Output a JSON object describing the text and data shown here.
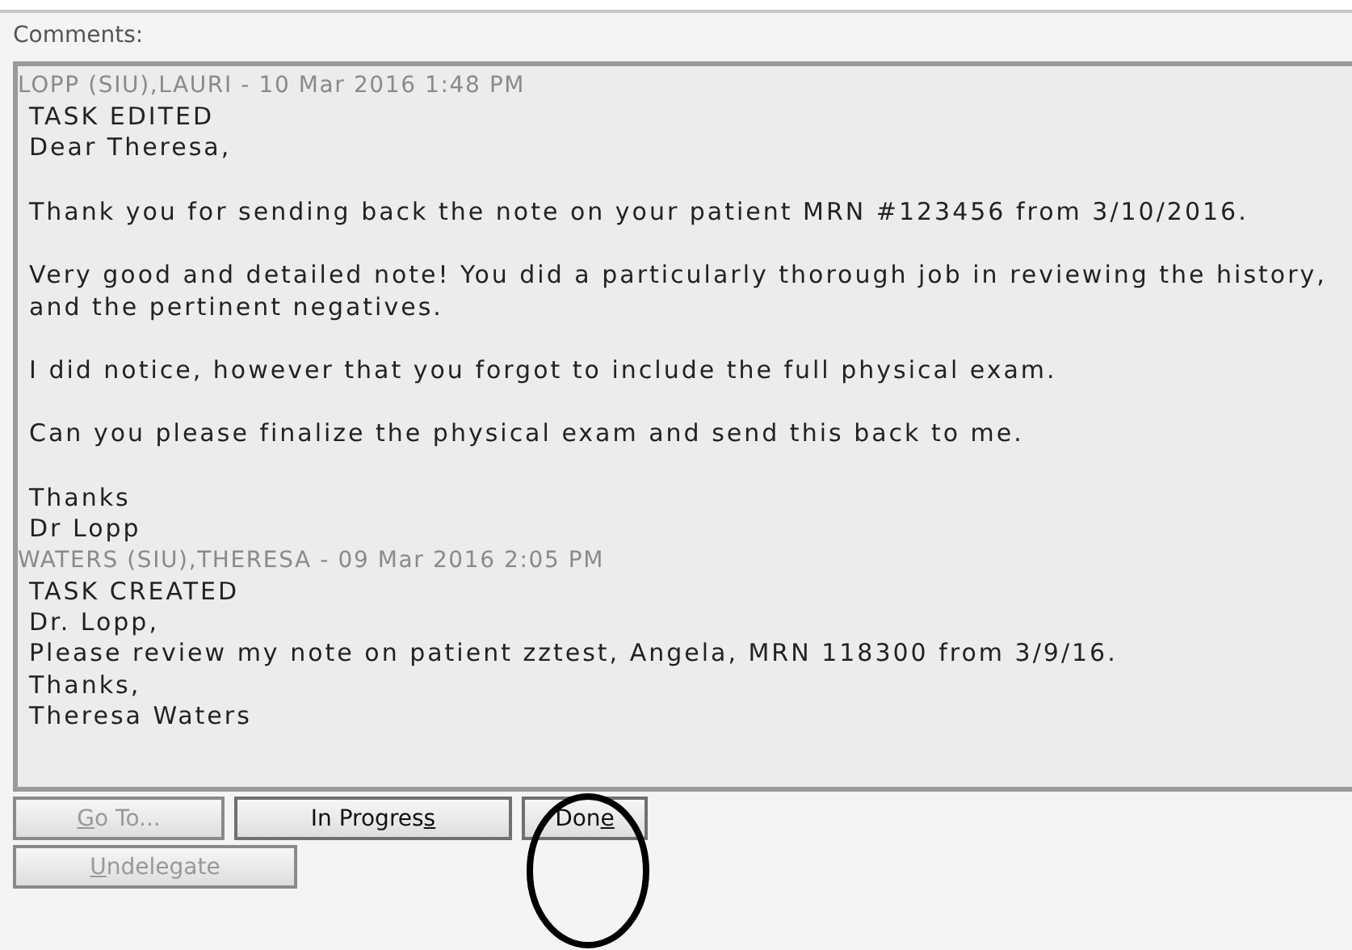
{
  "label": "Comments:",
  "comments": [
    {
      "header": "LOPP (SIU),LAURI - 10 Mar 2016 1:48 PM",
      "paragraphs": [
        [
          "TASK EDITED",
          "Dear Theresa,"
        ],
        [
          "Thank you for sending back the note on your patient MRN #123456 from 3/10/2016."
        ],
        [
          "Very good and detailed note! You did a particularly thorough job in reviewing the history,",
          "and the pertinent negatives."
        ],
        [
          "I did notice, however that you forgot to include the full physical exam."
        ],
        [
          "Can you please finalize the physical exam and send this back to me."
        ],
        [
          "Thanks",
          "Dr Lopp"
        ]
      ]
    },
    {
      "header": "WATERS (SIU),THERESA - 09 Mar 2016 2:05 PM",
      "paragraphs": [
        [
          "TASK CREATED",
          "Dr. Lopp,",
          "Please review my note on patient zztest, Angela, MRN 118300 from 3/9/16.",
          "Thanks,",
          "Theresa Waters"
        ]
      ]
    }
  ],
  "buttons": [
    [
      {
        "key": "G",
        "after": "o To...",
        "disabled": true,
        "circled": false
      },
      {
        "before": "In Progres",
        "key": "s",
        "disabled": false,
        "circled": false
      },
      {
        "before": "Don",
        "key": "e",
        "disabled": false,
        "circled": true
      }
    ],
    [
      {
        "key": "U",
        "after": "ndelegate",
        "disabled": true,
        "circled": false
      }
    ]
  ]
}
